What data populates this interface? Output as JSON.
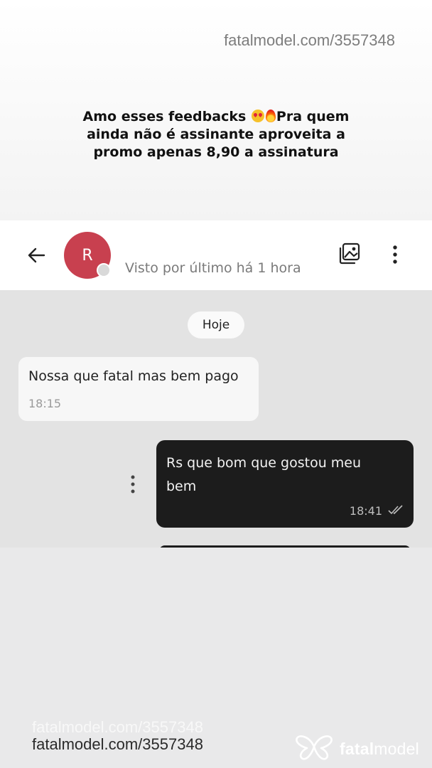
{
  "watermark": {
    "url": "fatalmodel.com/3557348",
    "brand_bold": "fatal",
    "brand_light": "model"
  },
  "caption": {
    "line_before": "Amo esses feedbacks",
    "line_after": "Pra quem ainda não é assinante aproveita a promo apenas 8,90 a assinatura",
    "emojis": [
      "smiling-face-with-heart-eyes",
      "fire"
    ]
  },
  "header": {
    "avatar_initial": "R",
    "last_seen": "Visto por último há 1 hora",
    "avatar_color": "#c8404f"
  },
  "chat": {
    "date_label": "Hoje",
    "messages": [
      {
        "direction": "incoming",
        "text": "Nossa que fatal mas bem pago",
        "time": "18:15"
      },
      {
        "direction": "outgoing",
        "text": "Rs que bom que gostou meu bem",
        "time": "18:41",
        "status": "read"
      }
    ]
  },
  "colors": {
    "outgoing_bubble": "#1c1c1c",
    "incoming_bubble": "#f7f7f7",
    "chat_background": "#e3e3e3"
  }
}
